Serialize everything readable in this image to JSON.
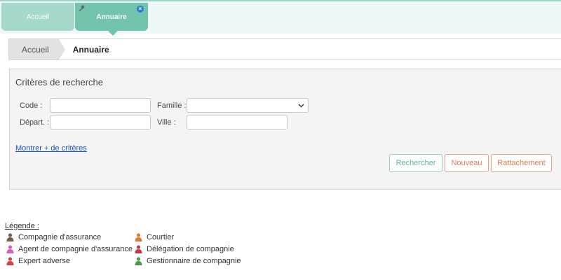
{
  "tabs": [
    {
      "label": "Accueil",
      "active": false
    },
    {
      "label": "Annuaire",
      "active": true
    }
  ],
  "breadcrumb": {
    "home": "Accueil",
    "current": "Annuaire"
  },
  "search": {
    "title": "Critères de recherche",
    "code_label": "Code :",
    "code_value": "",
    "famille_label": "Famille :",
    "famille_value": "",
    "depart_label": "Départ. :",
    "depart_value": "",
    "ville_label": "Ville :",
    "ville_value": "",
    "more_link": "Montrer + de critères"
  },
  "buttons": {
    "search": "Rechercher",
    "new": "Nouveau",
    "attach": "Rattachement"
  },
  "legend": {
    "title": "Légende :",
    "items": [
      {
        "label": "Compagnie d'assurance",
        "icon": "person-brown-icon",
        "color": "#7a5c3e"
      },
      {
        "label": "Agent de compagnie d'assurance",
        "icon": "person-pink-icon",
        "color": "#d85fb8"
      },
      {
        "label": "Expert adverse",
        "icon": "person-red-icon",
        "color": "#d83f3f"
      },
      {
        "label": "Courtier",
        "icon": "person-orange-icon",
        "color": "#e07a2e"
      },
      {
        "label": "Délégation de compagnie",
        "icon": "person-darkred-icon",
        "color": "#c23a4a"
      },
      {
        "label": "Gestionnaire de compagnie",
        "icon": "person-green-icon",
        "color": "#4a9a4a"
      }
    ]
  },
  "colors": {
    "accent": "#72c4ad",
    "link": "#1a56d6",
    "orange": "#e27c57"
  }
}
